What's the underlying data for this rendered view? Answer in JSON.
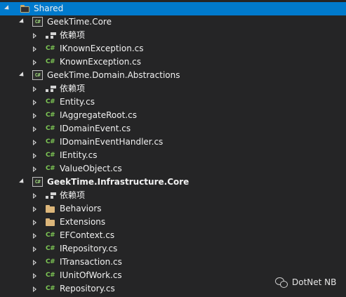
{
  "tree": {
    "root": {
      "label": "Shared",
      "expanded": true,
      "selected": true,
      "icon": "folder-icon"
    },
    "projects": [
      {
        "name": "GeekTime.Core",
        "bold": false,
        "icon": "csharp-project-icon",
        "children": [
          {
            "label": "依赖项",
            "icon": "dependencies-icon"
          },
          {
            "label": "IKnownException.cs",
            "icon": "csharp-file-icon"
          },
          {
            "label": "KnownException.cs",
            "icon": "csharp-file-icon"
          }
        ]
      },
      {
        "name": "GeekTime.Domain.Abstractions",
        "bold": false,
        "icon": "csharp-project-icon",
        "children": [
          {
            "label": "依赖项",
            "icon": "dependencies-icon"
          },
          {
            "label": "Entity.cs",
            "icon": "csharp-file-icon"
          },
          {
            "label": "IAggregateRoot.cs",
            "icon": "csharp-file-icon"
          },
          {
            "label": "IDomainEvent.cs",
            "icon": "csharp-file-icon"
          },
          {
            "label": "IDomainEventHandler.cs",
            "icon": "csharp-file-icon"
          },
          {
            "label": "IEntity.cs",
            "icon": "csharp-file-icon"
          },
          {
            "label": "ValueObject.cs",
            "icon": "csharp-file-icon"
          }
        ]
      },
      {
        "name": "GeekTime.Infrastructure.Core",
        "bold": true,
        "icon": "csharp-project-icon",
        "children": [
          {
            "label": "依赖项",
            "icon": "dependencies-icon"
          },
          {
            "label": "Behaviors",
            "icon": "folder-icon"
          },
          {
            "label": "Extensions",
            "icon": "folder-icon"
          },
          {
            "label": "EFContext.cs",
            "icon": "csharp-file-icon"
          },
          {
            "label": "IRepository.cs",
            "icon": "csharp-file-icon"
          },
          {
            "label": "ITransaction.cs",
            "icon": "csharp-file-icon"
          },
          {
            "label": "IUnitOfWork.cs",
            "icon": "csharp-file-icon"
          },
          {
            "label": "Repository.cs",
            "icon": "csharp-file-icon"
          }
        ]
      }
    ]
  },
  "icon_text": {
    "project": "C#",
    "file": "C#"
  },
  "watermark": {
    "text": "DotNet NB",
    "icon": "wechat-icon"
  },
  "colors": {
    "background": "#252526",
    "selection": "#007acc",
    "text": "#f1f1f1",
    "csharp_green": "#7ec855",
    "folder": "#dcb67a"
  }
}
